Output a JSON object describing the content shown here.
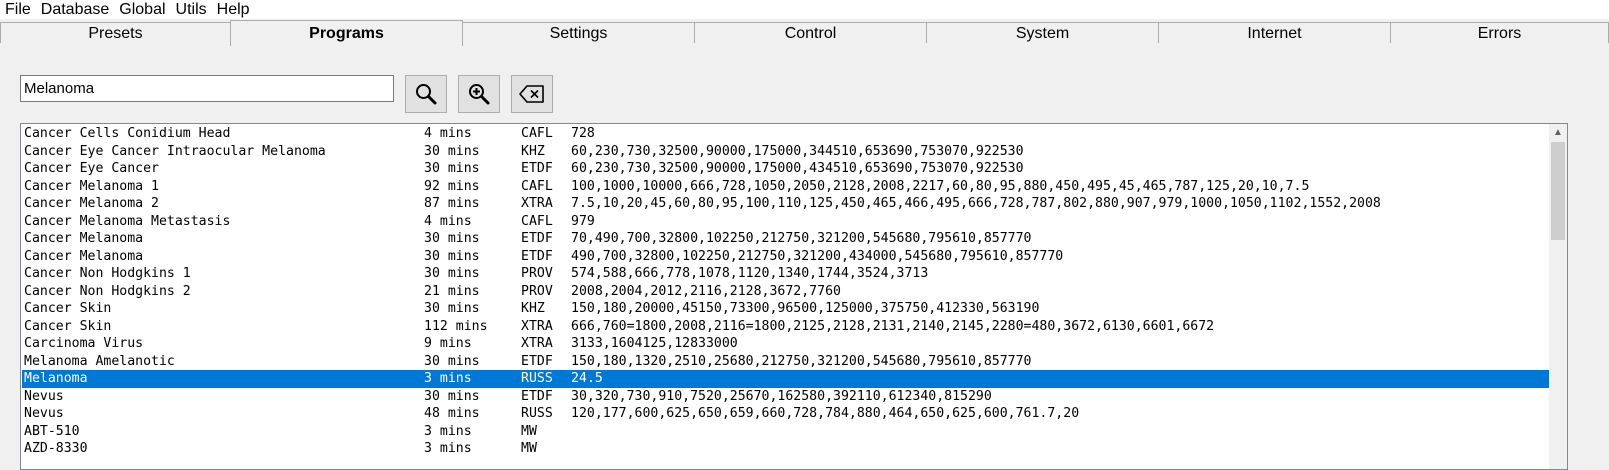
{
  "menu": [
    "File",
    "Database",
    "Global",
    "Utils",
    "Help"
  ],
  "tabs": [
    {
      "label": "Presets",
      "active": false
    },
    {
      "label": "Programs",
      "active": true
    },
    {
      "label": "Settings",
      "active": false
    },
    {
      "label": "Control",
      "active": false
    },
    {
      "label": "System",
      "active": false
    },
    {
      "label": "Internet",
      "active": false
    },
    {
      "label": "Errors",
      "active": false
    }
  ],
  "search": {
    "value": "Melanoma"
  },
  "toolbar": {
    "search_icon": "magnifier-icon",
    "zoom_icon": "zoom-in-icon",
    "clear_icon": "backspace-clear-icon"
  },
  "programs": [
    {
      "name": "Cancer Cells Conidium Head",
      "duration": "4 mins",
      "type": "CAFL",
      "frequencies": "728"
    },
    {
      "name": "Cancer Eye Cancer Intraocular Melanoma",
      "duration": "30 mins",
      "type": "KHZ",
      "frequencies": "60,230,730,32500,90000,175000,344510,653690,753070,922530"
    },
    {
      "name": "Cancer Eye Cancer",
      "duration": "30 mins",
      "type": "ETDF",
      "frequencies": "60,230,730,32500,90000,175000,434510,653690,753070,922530"
    },
    {
      "name": "Cancer Melanoma 1",
      "duration": "92 mins",
      "type": "CAFL",
      "frequencies": "100,1000,10000,666,728,1050,2050,2128,2008,2217,60,80,95,880,450,495,45,465,787,125,20,10,7.5"
    },
    {
      "name": "Cancer Melanoma 2",
      "duration": "87 mins",
      "type": "XTRA",
      "frequencies": "7.5,10,20,45,60,80,95,100,110,125,450,465,466,495,666,728,787,802,880,907,979,1000,1050,1102,1552,2008"
    },
    {
      "name": "Cancer Melanoma Metastasis",
      "duration": "4 mins",
      "type": "CAFL",
      "frequencies": "979"
    },
    {
      "name": "Cancer Melanoma",
      "duration": "30 mins",
      "type": "ETDF",
      "frequencies": "70,490,700,32800,102250,212750,321200,545680,795610,857770"
    },
    {
      "name": "Cancer Melanoma",
      "duration": "30 mins",
      "type": "ETDF",
      "frequencies": "490,700,32800,102250,212750,321200,434000,545680,795610,857770"
    },
    {
      "name": "Cancer Non Hodgkins 1",
      "duration": "30 mins",
      "type": "PROV",
      "frequencies": "574,588,666,778,1078,1120,1340,1744,3524,3713"
    },
    {
      "name": "Cancer Non Hodgkins 2",
      "duration": "21 mins",
      "type": "PROV",
      "frequencies": "2008,2004,2012,2116,2128,3672,7760"
    },
    {
      "name": "Cancer Skin",
      "duration": "30 mins",
      "type": "KHZ",
      "frequencies": "150,180,20000,45150,73300,96500,125000,375750,412330,563190"
    },
    {
      "name": "Cancer Skin",
      "duration": "112 mins",
      "type": "XTRA",
      "frequencies": "666,760=1800,2008,2116=1800,2125,2128,2131,2140,2145,2280=480,3672,6130,6601,6672"
    },
    {
      "name": "Carcinoma Virus",
      "duration": "9 mins",
      "type": "XTRA",
      "frequencies": "3133,1604125,12833000"
    },
    {
      "name": "Melanoma Amelanotic",
      "duration": "30 mins",
      "type": "ETDF",
      "frequencies": "150,180,1320,2510,25680,212750,321200,545680,795610,857770"
    },
    {
      "name": "Melanoma",
      "duration": "3 mins",
      "type": "RUSS",
      "frequencies": "24.5",
      "selected": true
    },
    {
      "name": "Nevus",
      "duration": "30 mins",
      "type": "ETDF",
      "frequencies": "30,320,730,910,7520,25670,162580,392110,612340,815290"
    },
    {
      "name": "Nevus",
      "duration": "48 mins",
      "type": "RUSS",
      "frequencies": "120,177,600,625,650,659,660,728,784,880,464,650,625,600,761.7,20"
    },
    {
      "name": "ABT-510",
      "duration": "3 mins",
      "type": "MW",
      "frequencies": ""
    },
    {
      "name": "AZD-8330",
      "duration": "3 mins",
      "type": "MW",
      "frequencies": ""
    }
  ],
  "colors": {
    "selection": "#0078d7",
    "background": "#f0f0f0"
  }
}
